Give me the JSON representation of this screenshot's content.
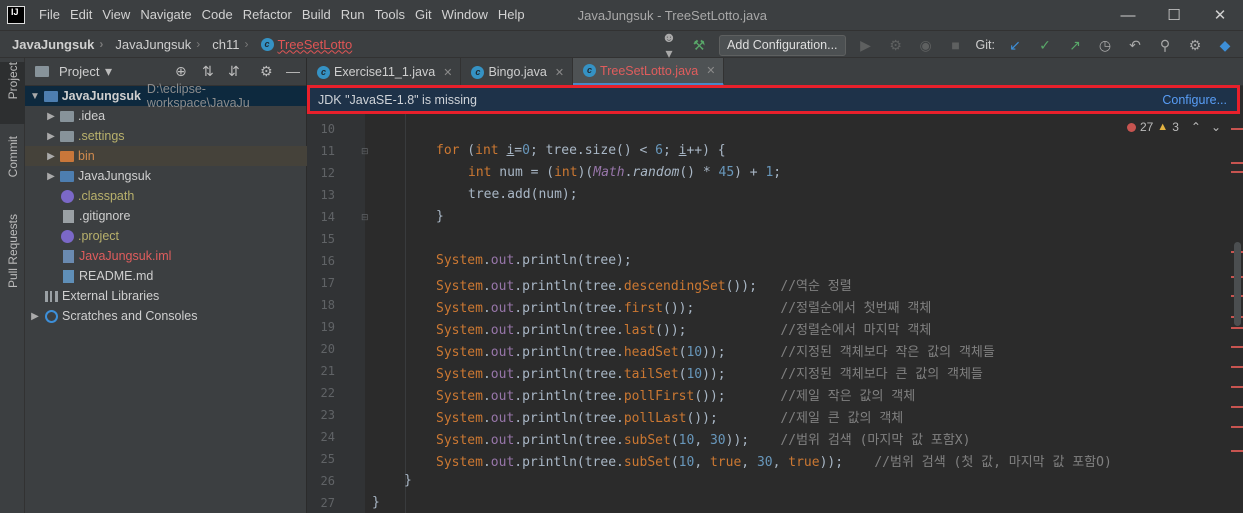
{
  "menu": [
    "File",
    "Edit",
    "View",
    "Navigate",
    "Code",
    "Refactor",
    "Build",
    "Run",
    "Tools",
    "Git",
    "Window",
    "Help"
  ],
  "window_title": "JavaJungsuk - TreeSetLotto.java",
  "breadcrumbs": [
    "JavaJungsuk",
    "JavaJungsuk",
    "ch11",
    "TreeSetLotto"
  ],
  "toolbar": {
    "add_configuration": "Add Configuration...",
    "git_label": "Git:"
  },
  "left_strip": [
    "Project",
    "Commit",
    "Pull Requests"
  ],
  "project_panel": {
    "title": "Project",
    "root_name": "JavaJungsuk",
    "root_path": "D:\\eclipse-workspace\\JavaJu",
    "items": [
      ".idea",
      ".settings",
      "bin",
      "JavaJungsuk",
      ".classpath",
      ".gitignore",
      ".project",
      "JavaJungsuk.iml",
      "README.md"
    ],
    "external": "External Libraries",
    "scratches": "Scratches and Consoles"
  },
  "tabs": [
    "Exercise11_1.java",
    "Bingo.java",
    "TreeSetLotto.java"
  ],
  "banner": {
    "message": "JDK \"JavaSE-1.8\" is missing",
    "link": "Configure..."
  },
  "inspections": {
    "errors": "27",
    "warnings": "3"
  },
  "line_numbers": [
    "10",
    "11",
    "12",
    "13",
    "14",
    "15",
    "16",
    "17",
    "18",
    "19",
    "20",
    "21",
    "22",
    "23",
    "24",
    "25",
    "26",
    "27"
  ],
  "comments": {
    "l17": "//역순 정렬",
    "l18": "//정렬순에서 첫번째 객체",
    "l19": "//정렬순에서 마지막 객체",
    "l20": "//지정된 객체보다 작은 값의 객체들",
    "l21": "//지정된 객체보다 큰 값의 객체들",
    "l22": "//제일 작은 값의 객체",
    "l23": "//제일 큰 값의 객체",
    "l24": "//범위 검색 (마지막 값 포함X)",
    "l25": "//범위 검색 (첫 값, 마지막 값 포함O)"
  }
}
